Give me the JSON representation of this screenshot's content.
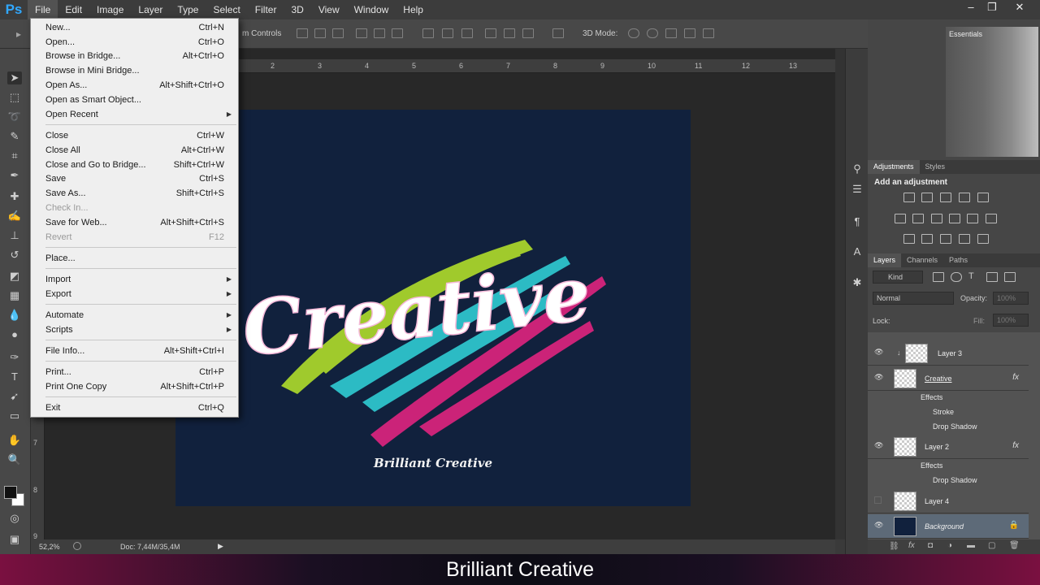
{
  "app": {
    "logo": "Ps"
  },
  "menubar": {
    "items": [
      "File",
      "Edit",
      "Image",
      "Layer",
      "Type",
      "Select",
      "Filter",
      "3D",
      "View",
      "Window",
      "Help"
    ],
    "active": "File"
  },
  "window_controls": {
    "minimize": "–",
    "restore": "❐",
    "close": "✕"
  },
  "options_bar": {
    "autoselect_text": "m Controls",
    "mode3d_label": "3D Mode:"
  },
  "file_menu": {
    "items": [
      {
        "label": "New...",
        "shortcut": "Ctrl+N"
      },
      {
        "label": "Open...",
        "shortcut": "Ctrl+O"
      },
      {
        "label": "Browse in Bridge...",
        "shortcut": "Alt+Ctrl+O"
      },
      {
        "label": "Browse in Mini Bridge...",
        "shortcut": ""
      },
      {
        "label": "Open As...",
        "shortcut": "Alt+Shift+Ctrl+O"
      },
      {
        "label": "Open as Smart Object...",
        "shortcut": ""
      },
      {
        "label": "Open Recent",
        "shortcut": "",
        "submenu": true
      },
      {
        "label": "Close",
        "shortcut": "Ctrl+W"
      },
      {
        "label": "Close All",
        "shortcut": "Alt+Ctrl+W"
      },
      {
        "label": "Close and Go to Bridge...",
        "shortcut": "Shift+Ctrl+W"
      },
      {
        "label": "Save",
        "shortcut": "Ctrl+S"
      },
      {
        "label": "Save As...",
        "shortcut": "Shift+Ctrl+S"
      },
      {
        "label": "Check In...",
        "shortcut": "",
        "disabled": true
      },
      {
        "label": "Save for Web...",
        "shortcut": "Alt+Shift+Ctrl+S"
      },
      {
        "label": "Revert",
        "shortcut": "F12",
        "disabled": true
      },
      {
        "label": "Place...",
        "shortcut": ""
      },
      {
        "label": "Import",
        "shortcut": "",
        "submenu": true
      },
      {
        "label": "Export",
        "shortcut": "",
        "submenu": true
      },
      {
        "label": "Automate",
        "shortcut": "",
        "submenu": true
      },
      {
        "label": "Scripts",
        "shortcut": "",
        "submenu": true
      },
      {
        "label": "File Info...",
        "shortcut": "Alt+Shift+Ctrl+I"
      },
      {
        "label": "Print...",
        "shortcut": "Ctrl+P"
      },
      {
        "label": "Print One Copy",
        "shortcut": "Alt+Shift+Ctrl+P"
      },
      {
        "label": "Exit",
        "shortcut": "Ctrl+Q"
      }
    ]
  },
  "ruler": {
    "top": [
      "2",
      "3",
      "4",
      "5",
      "6",
      "7",
      "8",
      "9",
      "10",
      "11",
      "12",
      "13"
    ],
    "left": [
      "7",
      "8",
      "9"
    ]
  },
  "document": {
    "title_word": "Creative",
    "subtitle": "Brilliant Creative",
    "background": "#11213d"
  },
  "status_bar": {
    "zoom": "52,2%",
    "doc_size": "Doc: 7,44M/35,4M"
  },
  "workspace": {
    "label": "Essentials"
  },
  "adjustments": {
    "tabs": [
      "Adjustments",
      "Styles"
    ],
    "title": "Add an adjustment"
  },
  "layers_panel": {
    "tabs": [
      "Layers",
      "Channels",
      "Paths"
    ],
    "kind_filter": "Kind",
    "blend_mode": "Normal",
    "opacity_label": "Opacity:",
    "opacity_value": "100%",
    "lock_label": "Lock:",
    "fill_label": "Fill:",
    "fill_value": "100%",
    "layers": [
      {
        "name": "Layer 3",
        "visible": true,
        "clipped": true
      },
      {
        "name": "Creative",
        "visible": true,
        "fx": "fx",
        "effects_label": "Effects",
        "effects": [
          "Stroke",
          "Drop Shadow"
        ]
      },
      {
        "name": "Layer 2",
        "visible": true,
        "fx": "fx",
        "effects_label": "Effects",
        "effects": [
          "Drop Shadow"
        ]
      },
      {
        "name": "Layer 4",
        "visible": false
      },
      {
        "name": "Background",
        "visible": true,
        "locked": true
      }
    ]
  },
  "caption": {
    "text": "Brilliant Creative"
  },
  "colors": {
    "accent_ps": "#31a8ff",
    "brush_lime": "#a8d42c",
    "brush_cyan": "#2ec4cc",
    "brush_magenta": "#d6247c",
    "selected_layer": "#5d6a78"
  }
}
